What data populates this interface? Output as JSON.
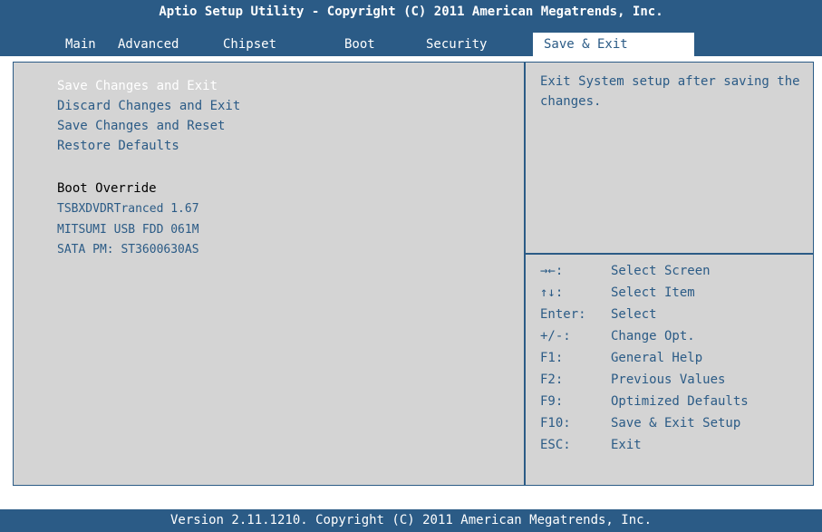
{
  "header": {
    "title": "Aptio Setup Utility - Copyright (C) 2011 American Megatrends, Inc.",
    "tabs": [
      "Main",
      "Advanced",
      "Chipset",
      "Boot",
      "Security",
      "Save & Exit"
    ],
    "active_tab": "Save & Exit"
  },
  "menu": {
    "items": [
      "Save Changes and Exit",
      "Discard Changes and Exit",
      "Save Changes and Reset",
      "Restore Defaults"
    ],
    "selected": "Save Changes and Exit",
    "boot_override_label": "Boot Override",
    "devices": [
      "TSBXDVDRTranced 1.67",
      "MITSUMI USB FDD 061M",
      "SATA  PM: ST3600630AS"
    ]
  },
  "help": {
    "text": "Exit System setup after saving the changes."
  },
  "keys": [
    {
      "key": "→←:",
      "desc": "Select Screen"
    },
    {
      "key": "↑↓:",
      "desc": "Select Item"
    },
    {
      "key": "Enter:",
      "desc": "Select"
    },
    {
      "key": "+/-:",
      "desc": "Change Opt."
    },
    {
      "key": "F1:",
      "desc": "General Help"
    },
    {
      "key": "F2:",
      "desc": "Previous Values"
    },
    {
      "key": "F9:",
      "desc": "Optimized Defaults"
    },
    {
      "key": "F10:",
      "desc": "Save & Exit Setup"
    },
    {
      "key": "ESC:",
      "desc": "Exit"
    }
  ],
  "footer": {
    "text": "Version 2.11.1210. Copyright (C) 2011 American Megatrends, Inc."
  },
  "colors": {
    "accent": "#2b5b86",
    "panel_bg": "#d4d4d4",
    "selected_text": "#ffffff"
  }
}
